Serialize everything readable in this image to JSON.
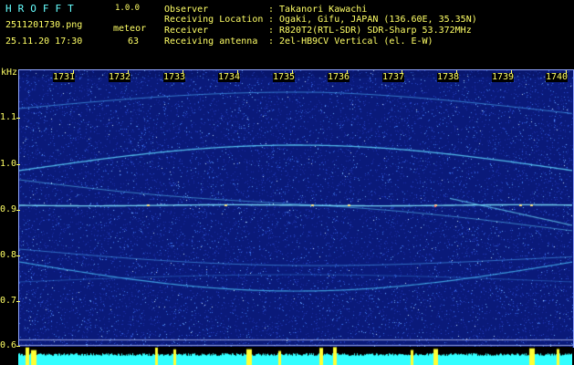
{
  "header": {
    "app_logo": "HROFFT",
    "app_version": "1.0.0",
    "file_name": "2511201730.png",
    "datetime": "25.11.20 17:30",
    "meteor_label": "meteor",
    "meteor_count": "63",
    "info": [
      {
        "key": "Observer",
        "value": "Takanori Kawachi"
      },
      {
        "key": "Receiving Location",
        "value": "Ogaki, Gifu, JAPAN (136.60E, 35.35N)"
      },
      {
        "key": "Receiver",
        "value": "R820T2(RTL-SDR) SDR-Sharp 53.372MHz"
      },
      {
        "key": "Receiving antenna",
        "value": "2el-HB9CV Vertical (el. E-W)"
      }
    ],
    "separator": ":"
  },
  "axes": {
    "y_unit": "kHz",
    "y_ticks": [
      "1.1",
      "1.0",
      "0.9",
      "0.8",
      "0.7",
      "0.6"
    ],
    "x_ticks": [
      "1731",
      "1732",
      "1733",
      "1734",
      "1735",
      "1736",
      "1737",
      "1738",
      "1739",
      "1740"
    ]
  },
  "colors": {
    "background": "#000000",
    "label_yellow": "#ffff66",
    "label_cyan": "#66ffff",
    "waterfall_base": "#0a1a7a",
    "trace": "#5fe0ff",
    "meteor_band": "#33ffff",
    "meteor_peak": "#ffff33"
  }
}
